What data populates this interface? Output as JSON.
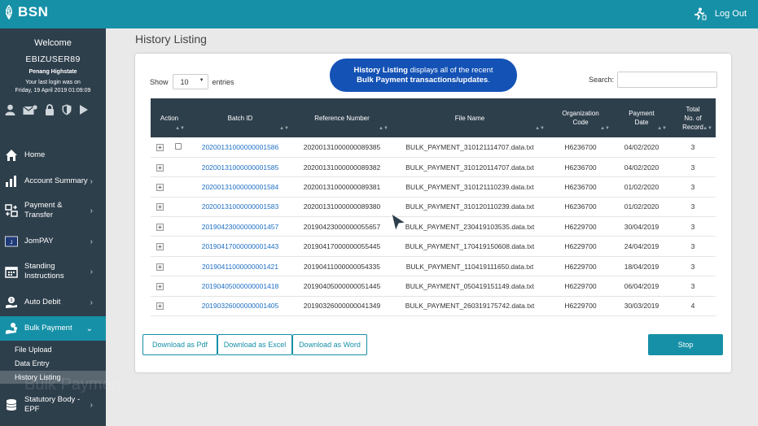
{
  "app": {
    "logo": "BSN",
    "logout": "Log Out"
  },
  "user": {
    "welcome": "Welcome",
    "username": "EBIZUSER89",
    "branch": "Penang Highstate",
    "last_login_label": "Your last login was on",
    "last_login": "Friday, 19 April 2019 01:09:09"
  },
  "quick_icons": [
    "user-icon",
    "mail-icon",
    "lock-icon",
    "shield-icon",
    "play-icon"
  ],
  "sidebar": {
    "items": [
      {
        "label": "Home",
        "icon": "home-icon"
      },
      {
        "label": "Account Summary",
        "icon": "bar-chart-icon"
      },
      {
        "label": "Payment &\nTransfer",
        "icon": "transfer-icon"
      },
      {
        "label": "JomPAY",
        "icon": "jompay-icon"
      },
      {
        "label": "Standing\nInstructions",
        "icon": "calendar-icon"
      },
      {
        "label": "Auto Debit",
        "icon": "money-hand-icon"
      },
      {
        "label": "Bulk Payment",
        "icon": "coins-hand-icon"
      },
      {
        "label": "Statutory Body -\nEPF",
        "icon": "coin-stack-icon"
      }
    ],
    "sub_items": [
      "File Upload",
      "Data Entry",
      "History Listing"
    ],
    "watermark": "Bulk Payment"
  },
  "page": {
    "title": "History Listing"
  },
  "controls": {
    "show_label": "Show",
    "entries_value": "10",
    "entries_label": "entries",
    "search_label": "Search:",
    "info_bold1": "History Listing",
    "info_text1": " displays all of the recent",
    "info_bold2": "Bulk Payment transactions/updates",
    "info_text2": "."
  },
  "table": {
    "columns": [
      "Action",
      "Batch ID",
      "Reference Number",
      "File Name",
      "Organization\nCode",
      "Payment\nDate",
      "Total\nNo. of\nRecord"
    ],
    "rows": [
      {
        "batch": "20200131000000001586",
        "ref": "20200131000000089385",
        "file": "BULK_PAYMENT_310121114707.data.txt",
        "org": "H6236700",
        "date": "04/02/2020",
        "total": "3"
      },
      {
        "batch": "20200131000000001585",
        "ref": "20200131000000089382",
        "file": "BULK_PAYMENT_310120114707.data.txt",
        "org": "H6236700",
        "date": "04/02/2020",
        "total": "3"
      },
      {
        "batch": "20200131000000001584",
        "ref": "20200131000000089381",
        "file": "BULK_PAYMENT_310121110239.data.txt",
        "org": "H6236700",
        "date": "01/02/2020",
        "total": "3"
      },
      {
        "batch": "20200131000000001583",
        "ref": "20200131000000089380",
        "file": "BULK_PAYMENT_310120110239.data.txt",
        "org": "H6236700",
        "date": "01/02/2020",
        "total": "3"
      },
      {
        "batch": "20190423000000001457",
        "ref": "20190423000000055657",
        "file": "BULK_PAYMENT_230419103535.data.txt",
        "org": "H6229700",
        "date": "30/04/2019",
        "total": "3"
      },
      {
        "batch": "20190417000000001443",
        "ref": "20190417000000055445",
        "file": "BULK_PAYMENT_170419150608.data.txt",
        "org": "H6229700",
        "date": "24/04/2019",
        "total": "3"
      },
      {
        "batch": "20190411000000001421",
        "ref": "20190411000000054335",
        "file": "BULK_PAYMENT_110419111650.data.txt",
        "org": "H6229700",
        "date": "18/04/2019",
        "total": "3"
      },
      {
        "batch": "20190405000000001418",
        "ref": "20190405000000051445",
        "file": "BULK_PAYMENT_050419151149.data.txt",
        "org": "H6229700",
        "date": "06/04/2019",
        "total": "3"
      },
      {
        "batch": "20190326000000001405",
        "ref": "20190326000000041349",
        "file": "BULK_PAYMENT_260319175742.data.txt",
        "org": "H6229700",
        "date": "30/03/2019",
        "total": "4"
      }
    ]
  },
  "buttons": {
    "pdf": "Download as Pdf",
    "excel": "Download as Excel",
    "word": "Download as Word",
    "stop": "Stop"
  },
  "colors": {
    "topbar": "#1690a7",
    "sidebar": "#2e3f4c",
    "info": "#1452b5",
    "link": "#1e6fc4"
  }
}
